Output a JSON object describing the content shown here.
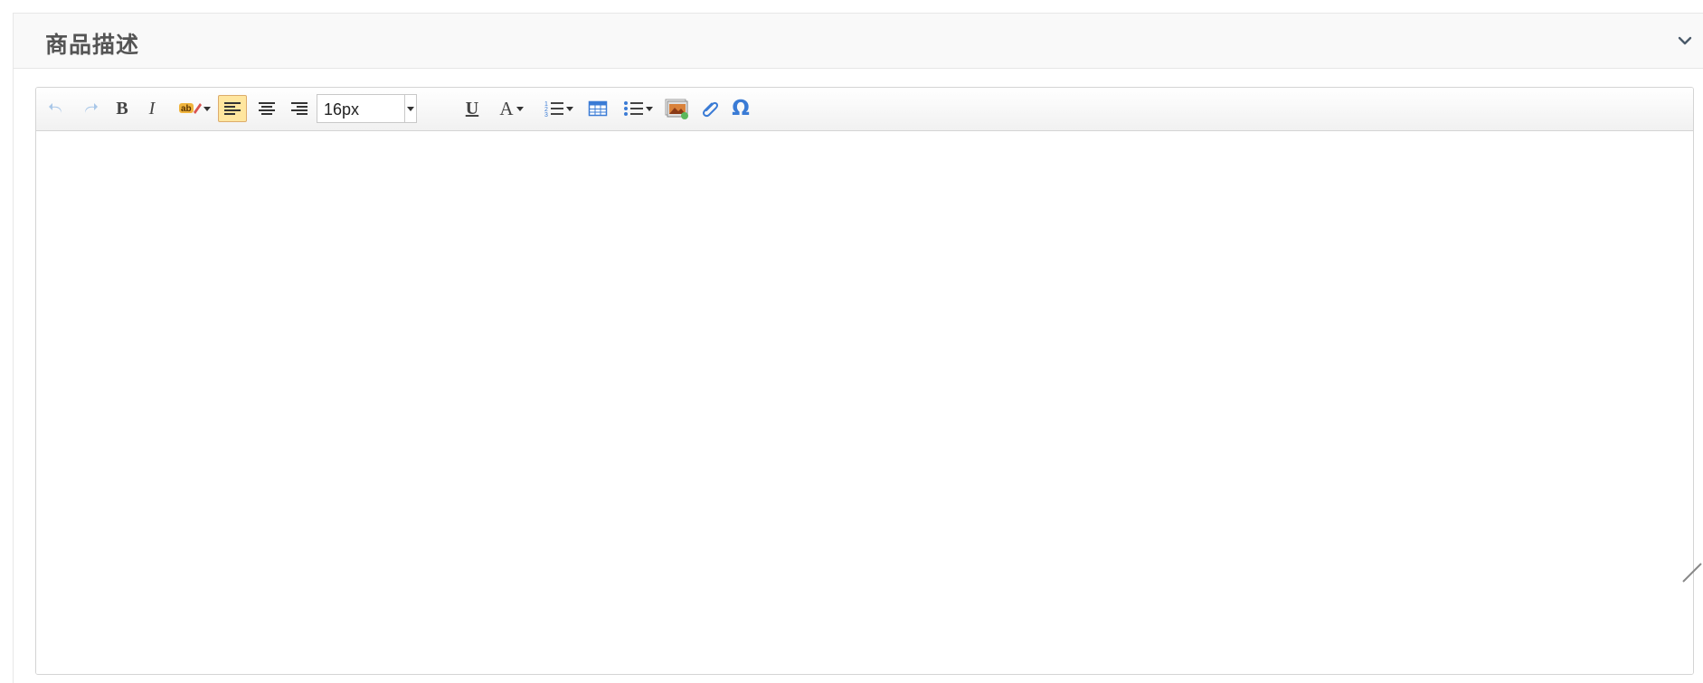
{
  "panel": {
    "title": "商品描述",
    "collapse_icon": "chevron-down-icon"
  },
  "toolbar": {
    "undo_icon": "undo-icon",
    "redo_icon": "redo-icon",
    "bold_label": "B",
    "italic_label": "I",
    "highlight_icon": "highlight-icon",
    "align_left_icon": "align-left-icon",
    "align_center_icon": "align-center-icon",
    "align_right_icon": "align-right-icon",
    "font_size_value": "16px",
    "underline_label": "U",
    "font_color_label": "A",
    "ordered_list_icon": "ordered-list-icon",
    "table_icon": "table-icon",
    "unordered_list_icon": "unordered-list-icon",
    "image_icon": "image-icon",
    "attachment_icon": "paperclip-icon",
    "special_char_label": "Ω"
  },
  "colors": {
    "accent_blue": "#3a7bd5",
    "active_bg": "#ffe69f",
    "title_text": "#555555"
  }
}
